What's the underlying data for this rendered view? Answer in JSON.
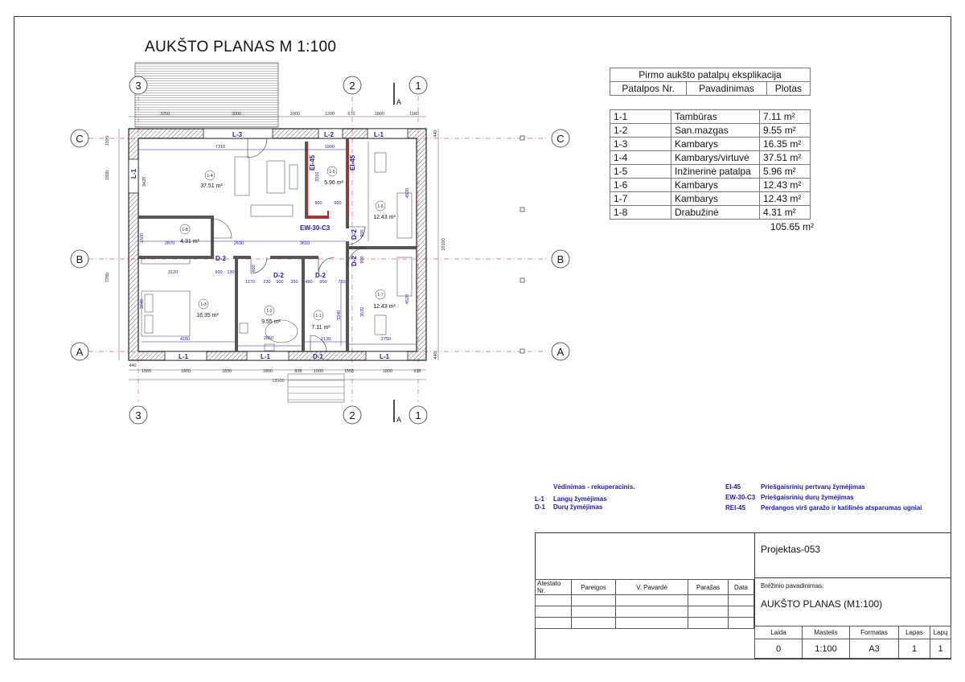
{
  "drawing_title": "AUKŠTO PLANAS M  1:100",
  "explication": {
    "caption": "Pirmo aukšto patalpų eksplikacija",
    "headers": [
      "Patalpos Nr.",
      "Pavadinimas",
      "Plotas"
    ],
    "rows": [
      {
        "nr": "1-1",
        "name": "Tambūras",
        "area": "7.11 m²"
      },
      {
        "nr": "1-2",
        "name": "San.mazgas",
        "area": "9.55 m²"
      },
      {
        "nr": "1-3",
        "name": "Kambarys",
        "area": "16.35 m²"
      },
      {
        "nr": "1-4",
        "name": "Kambarys/virtuvė",
        "area": "37.51 m²"
      },
      {
        "nr": "1-5",
        "name": "Inžinerinė patalpa",
        "area": "5.96 m²"
      },
      {
        "nr": "1-6",
        "name": "Kambarys",
        "area": "12.43 m²"
      },
      {
        "nr": "1-7",
        "name": "Kambarys",
        "area": "12.43 m²"
      },
      {
        "nr": "1-8",
        "name": "Drabužinė",
        "area": "4.31 m²"
      }
    ],
    "total": "105.65 m²"
  },
  "grid_axes": {
    "numbers_top": [
      "3",
      "2",
      "1"
    ],
    "numbers_bottom": [
      "3",
      "2",
      "1"
    ],
    "letters_left": [
      "C",
      "B",
      "A"
    ],
    "letters_right": [
      "C",
      "B",
      "A"
    ],
    "section_mark": "A"
  },
  "rooms": [
    {
      "id": "1-4",
      "area": "37.51 m²"
    },
    {
      "id": "1-5",
      "area": "5.96 m²"
    },
    {
      "id": "1-6",
      "area": "12.43 m²"
    },
    {
      "id": "1-8",
      "area": "4.31 m²"
    },
    {
      "id": "1-3",
      "area": "16.35 m²"
    },
    {
      "id": "1-2",
      "area": "9.55 m²"
    },
    {
      "id": "1-1",
      "area": "7.11 m²"
    },
    {
      "id": "1-7",
      "area": "12.43 m²"
    }
  ],
  "plan_tags": {
    "windows": [
      "L-3",
      "L-2",
      "L-1",
      "L-1",
      "L-1",
      "L-1",
      "L-1"
    ],
    "doors": [
      "D-2",
      "D-2",
      "D-2",
      "D-2",
      "D-2",
      "D-1"
    ],
    "fire_walls": [
      "EI-45",
      "EI-45"
    ],
    "fire_door": "EW-30-C3"
  },
  "dimensions": {
    "top": [
      "3250",
      "3000",
      "2000",
      "1200",
      "670",
      "1800",
      "1180"
    ],
    "bottom": [
      "1565",
      "1800",
      "1830",
      "1800",
      "835",
      "1000",
      "1555",
      "1800",
      "915"
    ],
    "bottom_total": "13100",
    "left": [
      "1020",
      "1800",
      "7280"
    ],
    "right": [
      "440",
      "10100",
      "440"
    ],
    "interior": [
      "7310",
      "1800",
      "3420",
      "3310",
      "800",
      "900",
      "4520",
      "1500",
      "2870",
      "2630",
      "3610",
      "900",
      "900",
      "3120",
      "900",
      "130",
      "600",
      "1170",
      "230",
      "900",
      "350",
      "480",
      "900",
      "750",
      "3940",
      "2650",
      "3340",
      "3570",
      "4520",
      "4150",
      "2130",
      "2750"
    ],
    "corner": "440"
  },
  "legend": {
    "ventilation": "Vėdinimas - rekuperacinis.",
    "left_items": [
      {
        "code": "L-1",
        "text": "Langų žymėjimas"
      },
      {
        "code": "D-1",
        "text": "Durų žymėjimas"
      }
    ],
    "right_items": [
      {
        "code": "EI-45",
        "text": "Priešgaisrinių pertvarų žymėjimas"
      },
      {
        "code": "EW-30-C3",
        "text": "Priešgaisrinių durų žymėjimas"
      },
      {
        "code": "REI-45",
        "text": "Perdangos virš garažo ir katilinės  atsparumas ugniai"
      }
    ]
  },
  "title_block": {
    "project": "Projektas-053",
    "sign_headers": [
      "Atestato Nr.",
      "Pareigos",
      "V. Pavardė",
      "Parašas",
      "Data"
    ],
    "drawing_name_label": "Brėžinio pavadinimas:",
    "drawing_name": "AUKŠTO PLANAS (M1:100)",
    "info_headers": [
      "Laida",
      "Mastelis",
      "Formatas",
      "Lapas",
      "Lapų"
    ],
    "info_values": [
      "0",
      "1:100",
      "A3",
      "1",
      "1"
    ]
  },
  "colors": {
    "fire_marking": "#d42020",
    "annotation_blue": "#1a1aa8",
    "grid_axis": "#e05a80"
  }
}
